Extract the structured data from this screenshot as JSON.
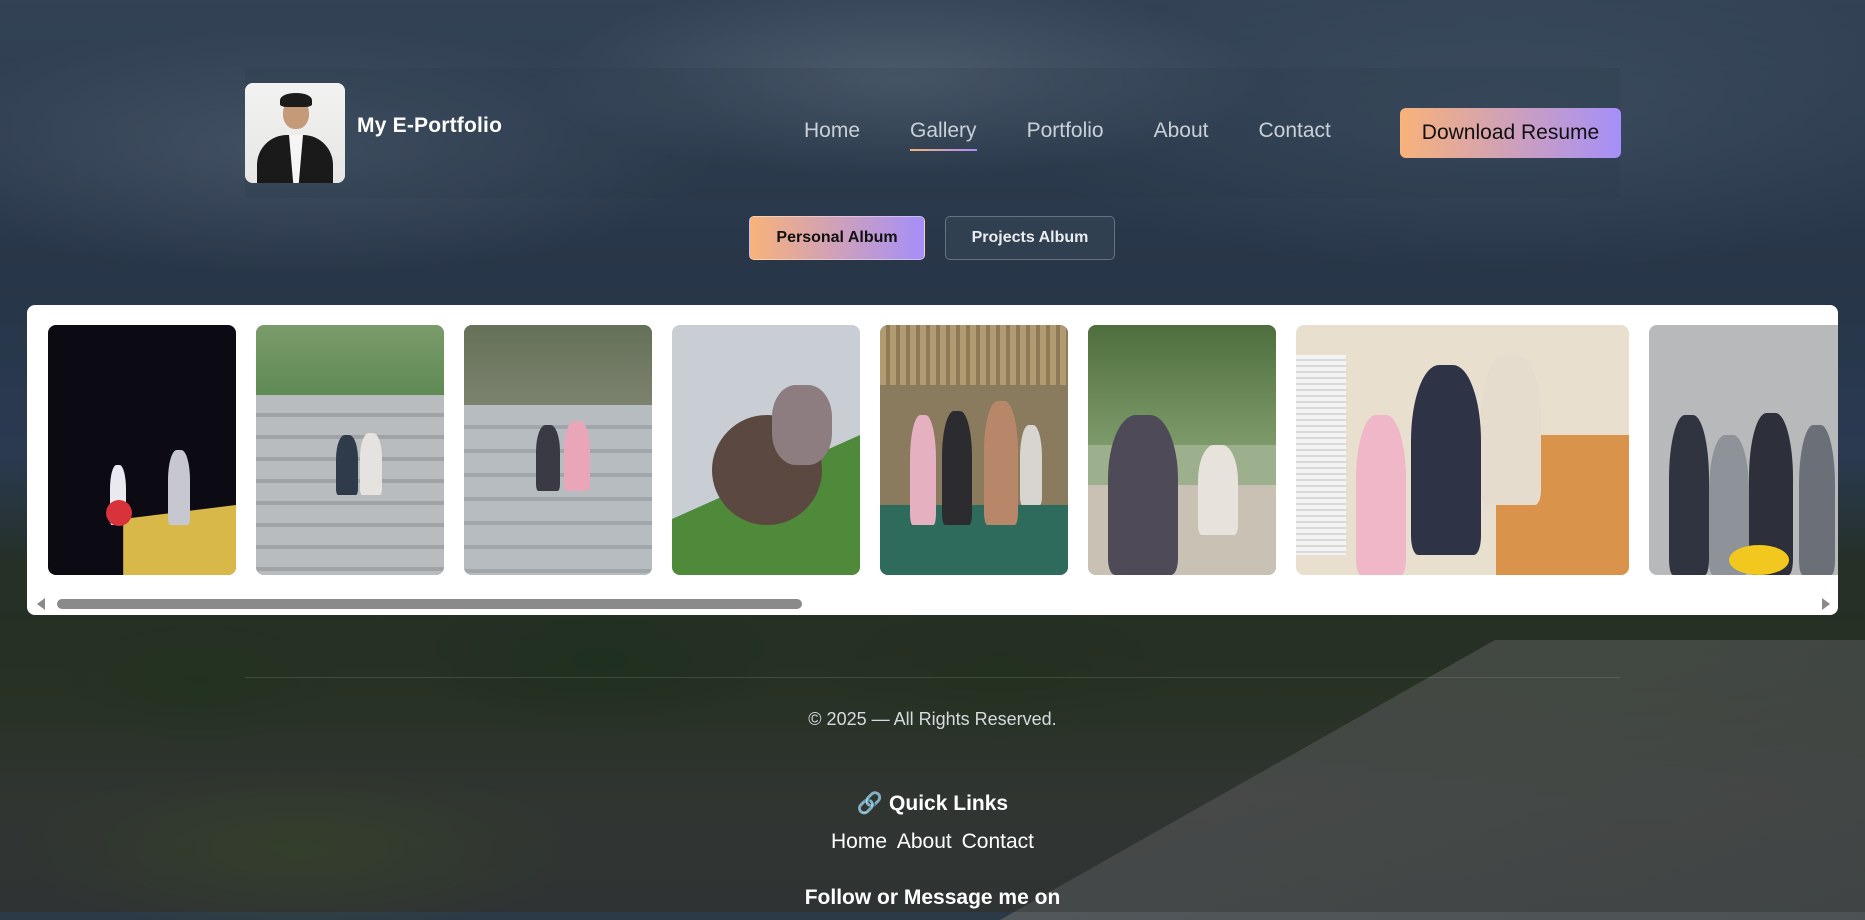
{
  "header": {
    "brand": "My E-Portfolio",
    "nav": [
      {
        "label": "Home",
        "active": false
      },
      {
        "label": "Gallery",
        "active": true
      },
      {
        "label": "Portfolio",
        "active": false
      },
      {
        "label": "About",
        "active": false
      },
      {
        "label": "Contact",
        "active": false
      }
    ],
    "download_button": "Download Resume"
  },
  "albums": {
    "personal": "Personal Album",
    "projects": "Projects Album",
    "selected": "Personal Album"
  },
  "footer": {
    "copyright": "© 2025 — All Rights Reserved.",
    "quick_links_icon": "link-icon",
    "quick_links_title": "Quick Links",
    "quick_links": [
      "Home",
      "About",
      "Contact"
    ],
    "follow_text": "Follow or Message me on"
  },
  "colors": {
    "accent_start": "#f8b27a",
    "accent_end": "#a58ff9"
  }
}
